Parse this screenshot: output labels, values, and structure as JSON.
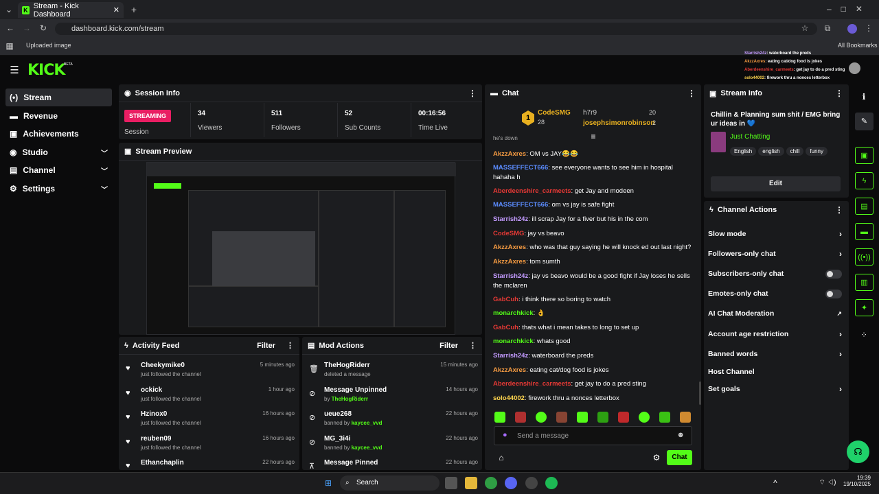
{
  "browser": {
    "tab_title": "Stream - Kick Dashboard",
    "url": "dashboard.kick.com/stream",
    "bookmark": "Uploaded image",
    "all_bookmarks": "All Bookmarks"
  },
  "colors": {
    "accent": "#53fc18",
    "live": "#e91e63"
  },
  "logo": "KICK",
  "beta": "BETA",
  "sidebar": {
    "items": [
      {
        "label": "Stream",
        "icon": "stream-icon"
      },
      {
        "label": "Revenue",
        "icon": "revenue-icon"
      },
      {
        "label": "Achievements",
        "icon": "trophy-icon"
      },
      {
        "label": "Studio",
        "icon": "studio-icon"
      },
      {
        "label": "Channel",
        "icon": "channel-icon"
      },
      {
        "label": "Settings",
        "icon": "gear-icon"
      }
    ]
  },
  "session": {
    "title": "Session Info",
    "badge": "STREAMING",
    "session_label": "Session",
    "stats": [
      {
        "value": "34",
        "label": "Viewers"
      },
      {
        "value": "511",
        "label": "Followers"
      },
      {
        "value": "52",
        "label": "Sub Counts"
      },
      {
        "value": "00:16:56",
        "label": "Time Live"
      }
    ]
  },
  "preview": {
    "title": "Stream Preview"
  },
  "activity": {
    "title": "Activity Feed",
    "filter": "Filter",
    "rows": [
      {
        "name": "Cheekymike0",
        "sub": "just followed the channel",
        "time": "5 minutes ago"
      },
      {
        "name": "ockick",
        "sub": "just followed the channel",
        "time": "1 hour ago"
      },
      {
        "name": "Hzinox0",
        "sub": "just followed the channel",
        "time": "16 hours ago"
      },
      {
        "name": "reuben09",
        "sub": "just followed the channel",
        "time": "16 hours ago"
      },
      {
        "name": "Ethanchaplin",
        "sub": "",
        "time": "22 hours ago"
      }
    ]
  },
  "mod": {
    "title": "Mod Actions",
    "filter": "Filter",
    "rows": [
      {
        "name": "TheHogRiderr",
        "sub": "deleted a message",
        "by": "",
        "time": "15 minutes ago"
      },
      {
        "name": "Message Unpinned",
        "sub": "by ",
        "by": "TheHogRiderr",
        "time": "14 hours ago"
      },
      {
        "name": "ueue268",
        "sub": "banned by ",
        "by": "kaycee_vvd",
        "time": "22 hours ago"
      },
      {
        "name": "MG_3i4i",
        "sub": "banned by ",
        "by": "kaycee_vvd",
        "time": "22 hours ago"
      },
      {
        "name": "Message Pinned",
        "sub": "",
        "by": "",
        "time": "22 hours ago"
      }
    ]
  },
  "chat": {
    "title": "Chat",
    "top1": {
      "rank": "1",
      "name": "CodeSMG",
      "count": "28"
    },
    "top2": {
      "name": "h7r9",
      "count": "20"
    },
    "top3": {
      "name": "josephsimonrobinson",
      "count": "2"
    },
    "partial": "he's down",
    "messages": [
      {
        "user": "AkzzAxres",
        "color": "#f59b42",
        "text": ": OM vs JAY😂😂"
      },
      {
        "user": "MASSEFFECT666",
        "color": "#5b8cff",
        "text": ": see everyone wants to see him in hospital hahaha h"
      },
      {
        "user": "Aberdeenshire_carmeets",
        "color": "#e53935",
        "text": ": get Jay and modeen"
      },
      {
        "user": "MASSEFFECT666",
        "color": "#5b8cff",
        "text": ": om vs jay is safe fight"
      },
      {
        "user": "Starrish24z",
        "color": "#c39bff",
        "text": ": ill scrap Jay for a fiver but his in the com"
      },
      {
        "user": "CodeSMG",
        "color": "#e53935",
        "text": ": jay vs beavo"
      },
      {
        "user": "AkzzAxres",
        "color": "#f59b42",
        "text": ": who was that guy saying he will knock ed out last night?"
      },
      {
        "user": "AkzzAxres",
        "color": "#f59b42",
        "text": ": tom sumth"
      },
      {
        "user": "Starrish24z",
        "color": "#c39bff",
        "text": ": jay vs beavo would be a good fight if Jay loses he sells the mclaren"
      },
      {
        "user": "GabCuh",
        "color": "#e53935",
        "text": ": i think there so boring to watch"
      },
      {
        "user": "monarchkick",
        "color": "#53fc18",
        "text": ": 👌"
      },
      {
        "user": "GabCuh",
        "color": "#e53935",
        "text": ": thats what i mean takes to long to set up"
      },
      {
        "user": "monarchkick",
        "color": "#53fc18",
        "text": ": whats good"
      },
      {
        "user": "Starrish24z",
        "color": "#c39bff",
        "text": ": waterboard the preds"
      },
      {
        "user": "AkzzAxres",
        "color": "#f59b42",
        "text": ": eating cat/dog food is jokes"
      },
      {
        "user": "Aberdeenshire_carmeets",
        "color": "#e53935",
        "text": ": get jay to do a pred sting"
      },
      {
        "user": "solo44002",
        "color": "#ffd54f",
        "text": ": firework thru a nonces letterbox"
      }
    ],
    "placeholder": "Send a message",
    "send": "Chat"
  },
  "overlay": [
    {
      "user": "Starrish24z",
      "text": ": waterboard the preds"
    },
    {
      "user": "AkzzAxres",
      "text": ": eating cat/dog food is jokes"
    },
    {
      "user": "Aberdeenshire_carmeets",
      "text": ": get jay to do a pred sting"
    },
    {
      "user": "solo44002",
      "text": ": firework thru a nonces letterbox"
    }
  ],
  "streaminfo": {
    "title": "Stream Info",
    "stream_title": "Chillin & Planning sum shit / EMG bring ur ideas in 💙",
    "category": "Just Chatting",
    "tags": [
      "English",
      "english",
      "chill",
      "funny"
    ],
    "edit": "Edit"
  },
  "actions": {
    "title": "Channel Actions",
    "rows": [
      {
        "label": "Slow mode",
        "kind": "chev"
      },
      {
        "label": "Followers-only chat",
        "kind": "chev"
      },
      {
        "label": "Subscribers-only chat",
        "kind": "toggle"
      },
      {
        "label": "Emotes-only chat",
        "kind": "toggle"
      },
      {
        "label": "AI Chat Moderation",
        "kind": "ext"
      },
      {
        "label": "Account age restriction",
        "kind": "chev"
      },
      {
        "label": "Banned words",
        "kind": "chev"
      },
      {
        "label": "Host Channel",
        "kind": "none"
      },
      {
        "label": "Set goals",
        "kind": "chev"
      }
    ]
  },
  "taskbar": {
    "search": "Search",
    "time": "19:39",
    "date": "19/10/2025"
  }
}
